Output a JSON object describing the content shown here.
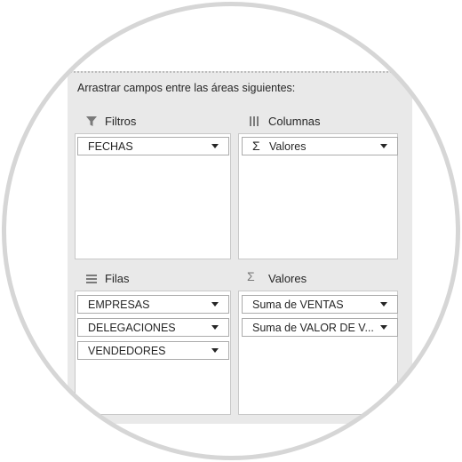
{
  "instruction": "Arrastrar campos entre las áreas siguientes:",
  "areas": {
    "filtros": {
      "title": "Filtros",
      "icon": "filter-icon",
      "fields": [
        {
          "label": "FECHAS"
        }
      ]
    },
    "columnas": {
      "title": "Columnas",
      "icon": "columns-icon",
      "fields": [
        {
          "label": "Valores",
          "sigma": "Σ"
        }
      ]
    },
    "filas": {
      "title": "Filas",
      "icon": "rows-icon",
      "fields": [
        {
          "label": "EMPRESAS"
        },
        {
          "label": "DELEGACIONES"
        },
        {
          "label": "VENDEDORES"
        }
      ]
    },
    "valores": {
      "title": "Valores",
      "icon": "sigma-icon",
      "icon_glyph": "Σ",
      "fields": [
        {
          "label": "Suma de VENTAS"
        },
        {
          "label": "Suma de VALOR DE V..."
        }
      ]
    }
  },
  "colors": {
    "panel_bg": "#e9e9e9",
    "area_bg": "#ffffff",
    "field_border": "#ababab",
    "ring": "#d6d6d6",
    "text": "#262626"
  }
}
